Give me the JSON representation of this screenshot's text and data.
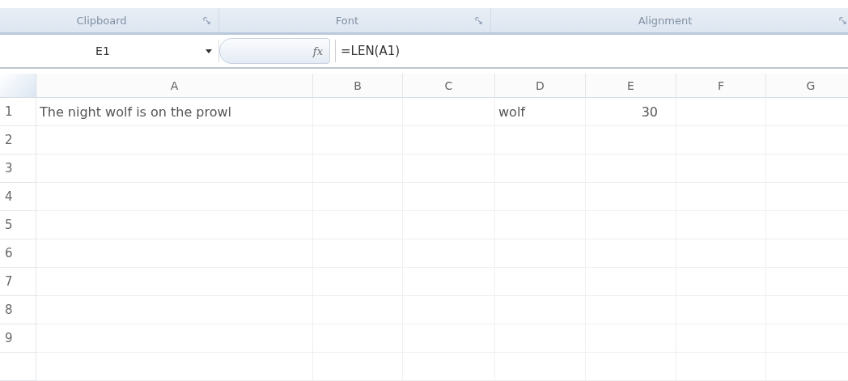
{
  "ribbon_groups": [
    {
      "label": "Clipboard"
    },
    {
      "label": "Font"
    },
    {
      "label": "Alignment"
    }
  ],
  "name_box": {
    "value": "E1"
  },
  "formula_bar": {
    "fx": "fx",
    "value": "=LEN(A1)"
  },
  "columns": [
    "A",
    "B",
    "C",
    "D",
    "E",
    "F",
    "G"
  ],
  "rows": [
    {
      "number": "1",
      "cells": [
        {
          "kind": "text",
          "text": "The night wolf is on the prowl"
        },
        null,
        null,
        {
          "kind": "text",
          "text": "wolf"
        },
        {
          "kind": "number",
          "text": "30"
        },
        null,
        null
      ]
    },
    {
      "number": "2"
    },
    {
      "number": "3"
    },
    {
      "number": "4"
    },
    {
      "number": "5"
    },
    {
      "number": "6"
    },
    {
      "number": "7"
    },
    {
      "number": "8"
    },
    {
      "number": "9"
    }
  ]
}
